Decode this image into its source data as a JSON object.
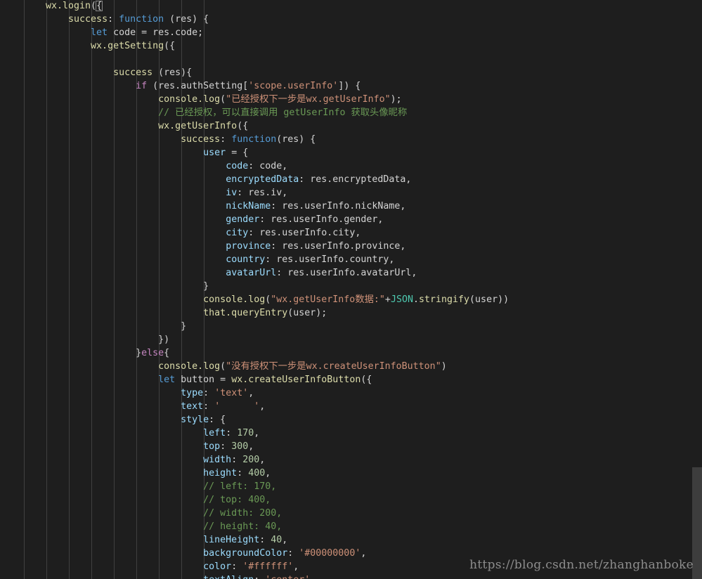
{
  "theme": {
    "background": "#1e1e1e",
    "plain": "#d4d4d4",
    "property": "#9cdcfe",
    "function": "#dcdcaa",
    "keyword": "#569cd6",
    "control": "#c586c0",
    "string": "#ce9178",
    "number": "#b5cea8",
    "comment": "#6a9955",
    "object": "#4ec9b0"
  },
  "code_lines": [
    [
      [
        "t-func",
        "wx.login"
      ],
      [
        "t-plain",
        "("
      ],
      [
        "t-plain",
        "{"
      ]
    ],
    [
      [
        "t-plain",
        "    "
      ],
      [
        "t-func",
        "success"
      ],
      [
        "t-plain",
        ": "
      ],
      [
        "t-kw",
        "function"
      ],
      [
        "t-plain",
        " (res) {"
      ]
    ],
    [
      [
        "t-plain",
        "        "
      ],
      [
        "t-kw",
        "let"
      ],
      [
        "t-plain",
        " code = res.code;"
      ]
    ],
    [
      [
        "t-plain",
        "        "
      ],
      [
        "t-func",
        "wx.getSetting"
      ],
      [
        "t-plain",
        "({"
      ]
    ],
    [
      [
        "t-plain",
        ""
      ]
    ],
    [
      [
        "t-plain",
        "            "
      ],
      [
        "t-func",
        "success"
      ],
      [
        "t-plain",
        " (res){"
      ]
    ],
    [
      [
        "t-plain",
        "                "
      ],
      [
        "t-ctrl",
        "if"
      ],
      [
        "t-plain",
        " (res.authSetting["
      ],
      [
        "t-str",
        "'scope.userInfo'"
      ],
      [
        "t-plain",
        "]) {"
      ]
    ],
    [
      [
        "t-plain",
        "                    "
      ],
      [
        "t-func",
        "console.log"
      ],
      [
        "t-plain",
        "("
      ],
      [
        "t-str",
        "\"已经授权下一步是wx.getUserInfo\""
      ],
      [
        "t-plain",
        ");"
      ]
    ],
    [
      [
        "t-plain",
        "                    "
      ],
      [
        "t-cmt",
        "// 已经授权，可以直接调用 getUserInfo 获取头像昵称"
      ]
    ],
    [
      [
        "t-plain",
        "                    "
      ],
      [
        "t-func",
        "wx.getUserInfo"
      ],
      [
        "t-plain",
        "({"
      ]
    ],
    [
      [
        "t-plain",
        "                        "
      ],
      [
        "t-func",
        "success"
      ],
      [
        "t-plain",
        ": "
      ],
      [
        "t-kw",
        "function"
      ],
      [
        "t-plain",
        "(res) {"
      ]
    ],
    [
      [
        "t-plain",
        "                            "
      ],
      [
        "t-var",
        "user"
      ],
      [
        "t-plain",
        " = {"
      ]
    ],
    [
      [
        "t-plain",
        "                                "
      ],
      [
        "t-prop",
        "code"
      ],
      [
        "t-plain",
        ": code,"
      ]
    ],
    [
      [
        "t-plain",
        "                                "
      ],
      [
        "t-prop",
        "encryptedData"
      ],
      [
        "t-plain",
        ": res.encryptedData,"
      ]
    ],
    [
      [
        "t-plain",
        "                                "
      ],
      [
        "t-prop",
        "iv"
      ],
      [
        "t-plain",
        ": res.iv,"
      ]
    ],
    [
      [
        "t-plain",
        "                                "
      ],
      [
        "t-prop",
        "nickName"
      ],
      [
        "t-plain",
        ": res.userInfo.nickName,"
      ]
    ],
    [
      [
        "t-plain",
        "                                "
      ],
      [
        "t-prop",
        "gender"
      ],
      [
        "t-plain",
        ": res.userInfo.gender,"
      ]
    ],
    [
      [
        "t-plain",
        "                                "
      ],
      [
        "t-prop",
        "city"
      ],
      [
        "t-plain",
        ": res.userInfo.city,"
      ]
    ],
    [
      [
        "t-plain",
        "                                "
      ],
      [
        "t-prop",
        "province"
      ],
      [
        "t-plain",
        ": res.userInfo.province,"
      ]
    ],
    [
      [
        "t-plain",
        "                                "
      ],
      [
        "t-prop",
        "country"
      ],
      [
        "t-plain",
        ": res.userInfo.country,"
      ]
    ],
    [
      [
        "t-plain",
        "                                "
      ],
      [
        "t-prop",
        "avatarUrl"
      ],
      [
        "t-plain",
        ": res.userInfo.avatarUrl,"
      ]
    ],
    [
      [
        "t-plain",
        "                            }"
      ]
    ],
    [
      [
        "t-plain",
        "                            "
      ],
      [
        "t-func",
        "console.log"
      ],
      [
        "t-plain",
        "("
      ],
      [
        "t-str",
        "\"wx.getUserInfo数据:\""
      ],
      [
        "t-plain",
        "+"
      ],
      [
        "t-obj",
        "JSON"
      ],
      [
        "t-plain",
        "."
      ],
      [
        "t-func",
        "stringify"
      ],
      [
        "t-plain",
        "(user))"
      ]
    ],
    [
      [
        "t-plain",
        "                            "
      ],
      [
        "t-func",
        "that.queryEntry"
      ],
      [
        "t-plain",
        "(user);"
      ]
    ],
    [
      [
        "t-plain",
        "                        }"
      ]
    ],
    [
      [
        "t-plain",
        "                    })"
      ]
    ],
    [
      [
        "t-plain",
        "                }"
      ],
      [
        "t-ctrl",
        "else"
      ],
      [
        "t-plain",
        "{"
      ]
    ],
    [
      [
        "t-plain",
        "                    "
      ],
      [
        "t-func",
        "console.log"
      ],
      [
        "t-plain",
        "("
      ],
      [
        "t-str",
        "\"没有授权下一步是wx.createUserInfoButton\""
      ],
      [
        "t-plain",
        ")"
      ]
    ],
    [
      [
        "t-plain",
        "                    "
      ],
      [
        "t-kw",
        "let"
      ],
      [
        "t-plain",
        " button = "
      ],
      [
        "t-func",
        "wx.createUserInfoButton"
      ],
      [
        "t-plain",
        "({"
      ]
    ],
    [
      [
        "t-plain",
        "                        "
      ],
      [
        "t-prop",
        "type"
      ],
      [
        "t-plain",
        ": "
      ],
      [
        "t-str",
        "'text'"
      ],
      [
        "t-plain",
        ","
      ]
    ],
    [
      [
        "t-plain",
        "                        "
      ],
      [
        "t-prop",
        "text"
      ],
      [
        "t-plain",
        ": "
      ],
      [
        "t-str",
        "'      '"
      ],
      [
        "t-plain",
        ","
      ]
    ],
    [
      [
        "t-plain",
        "                        "
      ],
      [
        "t-prop",
        "style"
      ],
      [
        "t-plain",
        ": {"
      ]
    ],
    [
      [
        "t-plain",
        "                            "
      ],
      [
        "t-prop",
        "left"
      ],
      [
        "t-plain",
        ": "
      ],
      [
        "t-num",
        "170"
      ],
      [
        "t-plain",
        ","
      ]
    ],
    [
      [
        "t-plain",
        "                            "
      ],
      [
        "t-prop",
        "top"
      ],
      [
        "t-plain",
        ": "
      ],
      [
        "t-num",
        "300"
      ],
      [
        "t-plain",
        ","
      ]
    ],
    [
      [
        "t-plain",
        "                            "
      ],
      [
        "t-prop",
        "width"
      ],
      [
        "t-plain",
        ": "
      ],
      [
        "t-num",
        "200"
      ],
      [
        "t-plain",
        ","
      ]
    ],
    [
      [
        "t-plain",
        "                            "
      ],
      [
        "t-prop",
        "height"
      ],
      [
        "t-plain",
        ": "
      ],
      [
        "t-num",
        "400"
      ],
      [
        "t-plain",
        ","
      ]
    ],
    [
      [
        "t-plain",
        "                            "
      ],
      [
        "t-cmt",
        "// left: 170,"
      ]
    ],
    [
      [
        "t-plain",
        "                            "
      ],
      [
        "t-cmt",
        "// top: 400,"
      ]
    ],
    [
      [
        "t-plain",
        "                            "
      ],
      [
        "t-cmt",
        "// width: 200,"
      ]
    ],
    [
      [
        "t-plain",
        "                            "
      ],
      [
        "t-cmt",
        "// height: 40,"
      ]
    ],
    [
      [
        "t-plain",
        "                            "
      ],
      [
        "t-prop",
        "lineHeight"
      ],
      [
        "t-plain",
        ": "
      ],
      [
        "t-num",
        "40"
      ],
      [
        "t-plain",
        ","
      ]
    ],
    [
      [
        "t-plain",
        "                            "
      ],
      [
        "t-prop",
        "backgroundColor"
      ],
      [
        "t-plain",
        ": "
      ],
      [
        "t-str",
        "'#00000000'"
      ],
      [
        "t-plain",
        ","
      ]
    ],
    [
      [
        "t-plain",
        "                            "
      ],
      [
        "t-prop",
        "color"
      ],
      [
        "t-plain",
        ": "
      ],
      [
        "t-str",
        "'#ffffff'"
      ],
      [
        "t-plain",
        ","
      ]
    ],
    [
      [
        "t-plain",
        "                            "
      ],
      [
        "t-prop",
        "textAlign"
      ],
      [
        "t-plain",
        ": "
      ],
      [
        "t-str",
        "'center'"
      ],
      [
        "t-plain",
        ","
      ]
    ]
  ],
  "watermark": "https://blog.csdn.net/zhanghanboke"
}
